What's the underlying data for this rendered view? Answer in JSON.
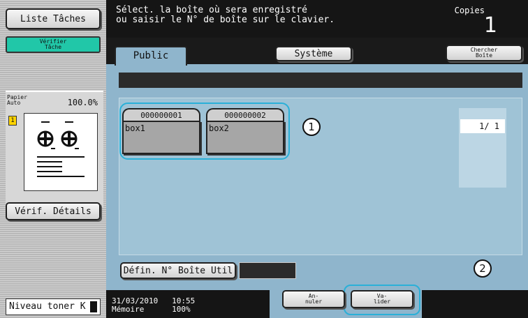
{
  "left_panel": {
    "job_list_label": "Liste Tâches",
    "check_job_line1": "Vérifier",
    "check_job_line2": "Tâche",
    "paper_line1": "Papier",
    "paper_line2": "Auto",
    "zoom": "100.0%",
    "page_badge": "1",
    "details_label": "Vérif. Détails",
    "toner_label": "Niveau toner",
    "toner_color_letter": "K"
  },
  "header": {
    "message_line1": "Sélect. la boîte où sera enregistré",
    "message_line2": "ou saisir le N° de boîte sur le clavier.",
    "copies_label": "Copies",
    "copies_value": "1"
  },
  "tabs": [
    {
      "label": "Public",
      "selected": true
    },
    {
      "label": "Système",
      "selected": false
    }
  ],
  "search_box_line1": "Chercher",
  "search_box_line2": "Boîte",
  "boxes": [
    {
      "number": "000000001",
      "name": "box1"
    },
    {
      "number": "000000002",
      "name": "box2"
    }
  ],
  "page_counter": "1/ 1",
  "user_box_no_label": "Défin. N° Boîte Util",
  "user_box_no_value": "",
  "callouts": [
    "1",
    "2"
  ],
  "status": {
    "date_time": "31/03/2010   10:55",
    "memory": "Mémoire      100%"
  },
  "buttons": {
    "cancel_line1": "An-",
    "cancel_line2": "nuler",
    "validate_line1": "Va-",
    "validate_line2": "lider"
  },
  "colors": {
    "accent_highlight": "#2ab0d8",
    "main_background": "#8fb5cc",
    "check_job_button": "#21c7a8",
    "header_background": "#151515"
  }
}
